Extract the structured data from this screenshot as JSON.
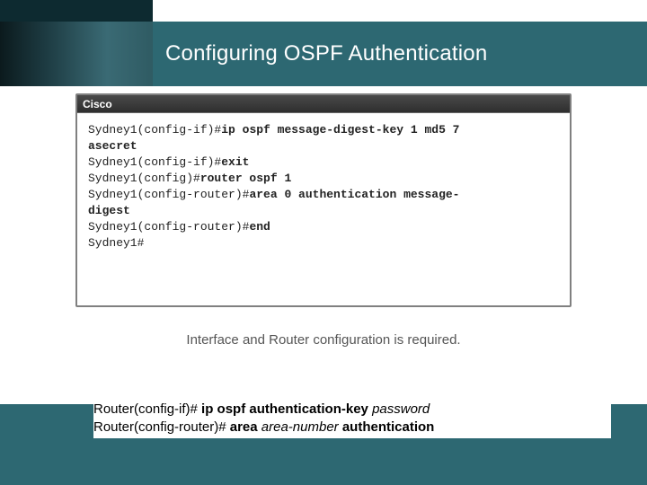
{
  "header": {
    "title": "Configuring OSPF Authentication"
  },
  "terminal": {
    "brand": "Cisco",
    "lines": [
      {
        "prompt": "Sydney1(config-if)#",
        "cmd": "ip ospf message-digest-key 1 md5 7"
      },
      {
        "prompt": "",
        "cmd": "asecret",
        "cmd_only_bold": true
      },
      {
        "prompt": "Sydney1(config-if)#",
        "cmd": "exit"
      },
      {
        "prompt": "Sydney1(config)#",
        "cmd": "router ospf 1"
      },
      {
        "prompt": "Sydney1(config-router)#",
        "cmd": "area 0 authentication message-"
      },
      {
        "prompt": "",
        "cmd": "digest",
        "cmd_only_bold": true
      },
      {
        "prompt": "Sydney1(config-router)#",
        "cmd": "end"
      },
      {
        "prompt": "Sydney1#",
        "cmd": ""
      }
    ]
  },
  "subcaption": "Interface and Router configuration is required.",
  "commands": {
    "line1_prefix": "Router(config-if)# ",
    "line1_kw": "ip ospf authentication-key",
    "line1_arg": " password",
    "line2_prefix": "Router(config-router)# ",
    "line2_kw_a": "area",
    "line2_arg_a": " area-number ",
    "line2_kw_b": "authentication"
  }
}
